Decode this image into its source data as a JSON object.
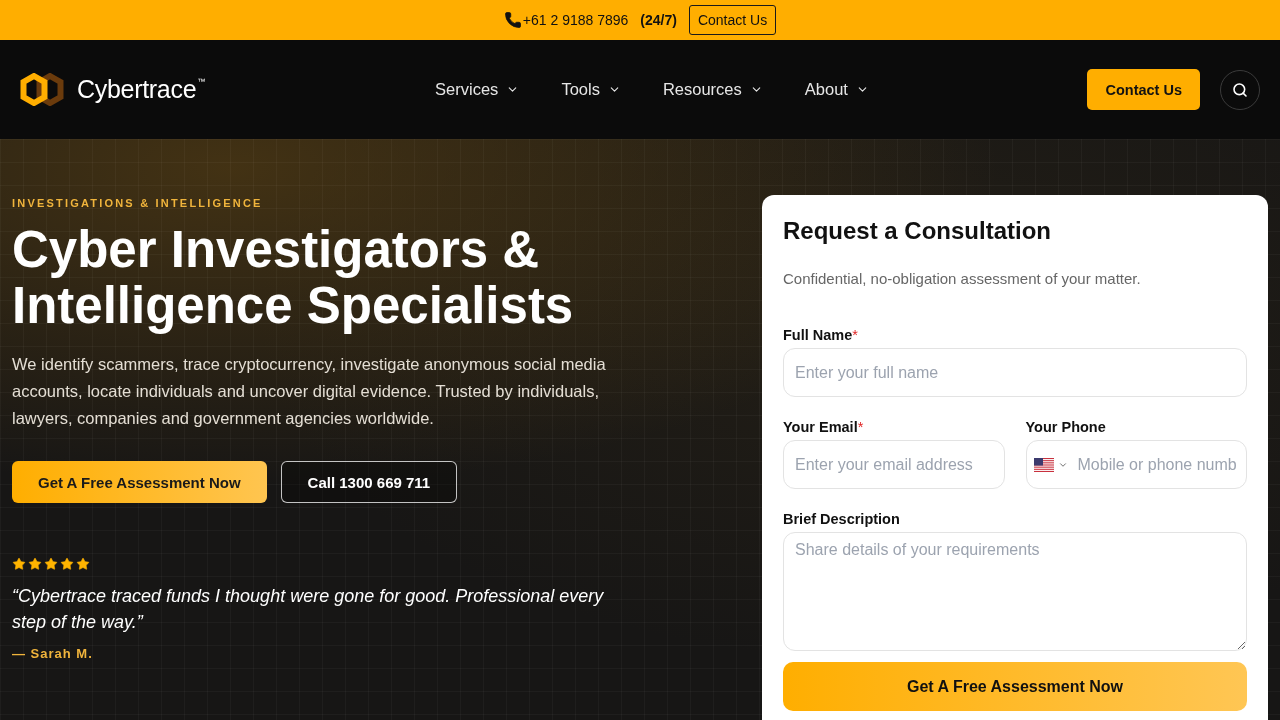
{
  "top_bar": {
    "phone": "+61 2 9188 7896",
    "hours": "(24/7)",
    "contact_button": "Contact Us"
  },
  "header": {
    "logo_text": "Cybertrace$^{™}$",
    "nav": [
      {
        "label": "Services"
      },
      {
        "label": "Tools"
      },
      {
        "label": "Resources"
      },
      {
        "label": "About"
      }
    ],
    "contact_button": "Contact Us"
  },
  "hero": {
    "eyebrow": "INVESTIGATIONS & INTELLIGENCE",
    "title": "Cyber Investigators & Intelligence Specialists",
    "description": "We identify scammers, trace cryptocurrency, investigate anonymous social media accounts, locate individuals and uncover digital evidence. Trusted by individuals, lawyers, companies and government agencies worldwide.",
    "buttons": [
      {
        "label": "Get A Free Assessment Now",
        "kind": "primary"
      },
      {
        "label": "Call 1300 669 711",
        "kind": "outline"
      }
    ],
    "testimonial": {
      "stars": 5,
      "quote": "“Cybertrace traced funds I thought were gone for good. Professional every step of the way.”",
      "author": "— Sarah M."
    }
  },
  "consultation_form": {
    "title": "Request a Consultation",
    "subtitle": "Confidential, no-obligation assessment of your matter.",
    "fields": [
      {
        "kind": "text",
        "label": "Full Name",
        "required_mark": "*",
        "placeholder": "Enter your full name"
      },
      {
        "kind": "email",
        "label": "Your Email",
        "required_mark": "*",
        "placeholder": "Enter your email address"
      },
      {
        "kind": "phone",
        "label": "Your Phone",
        "placeholder": "Mobile or phone numb"
      },
      {
        "kind": "textarea",
        "label": "Brief Description",
        "placeholder": "Share details of your requirements"
      }
    ],
    "submit": "Get A Free Assessment Now"
  }
}
